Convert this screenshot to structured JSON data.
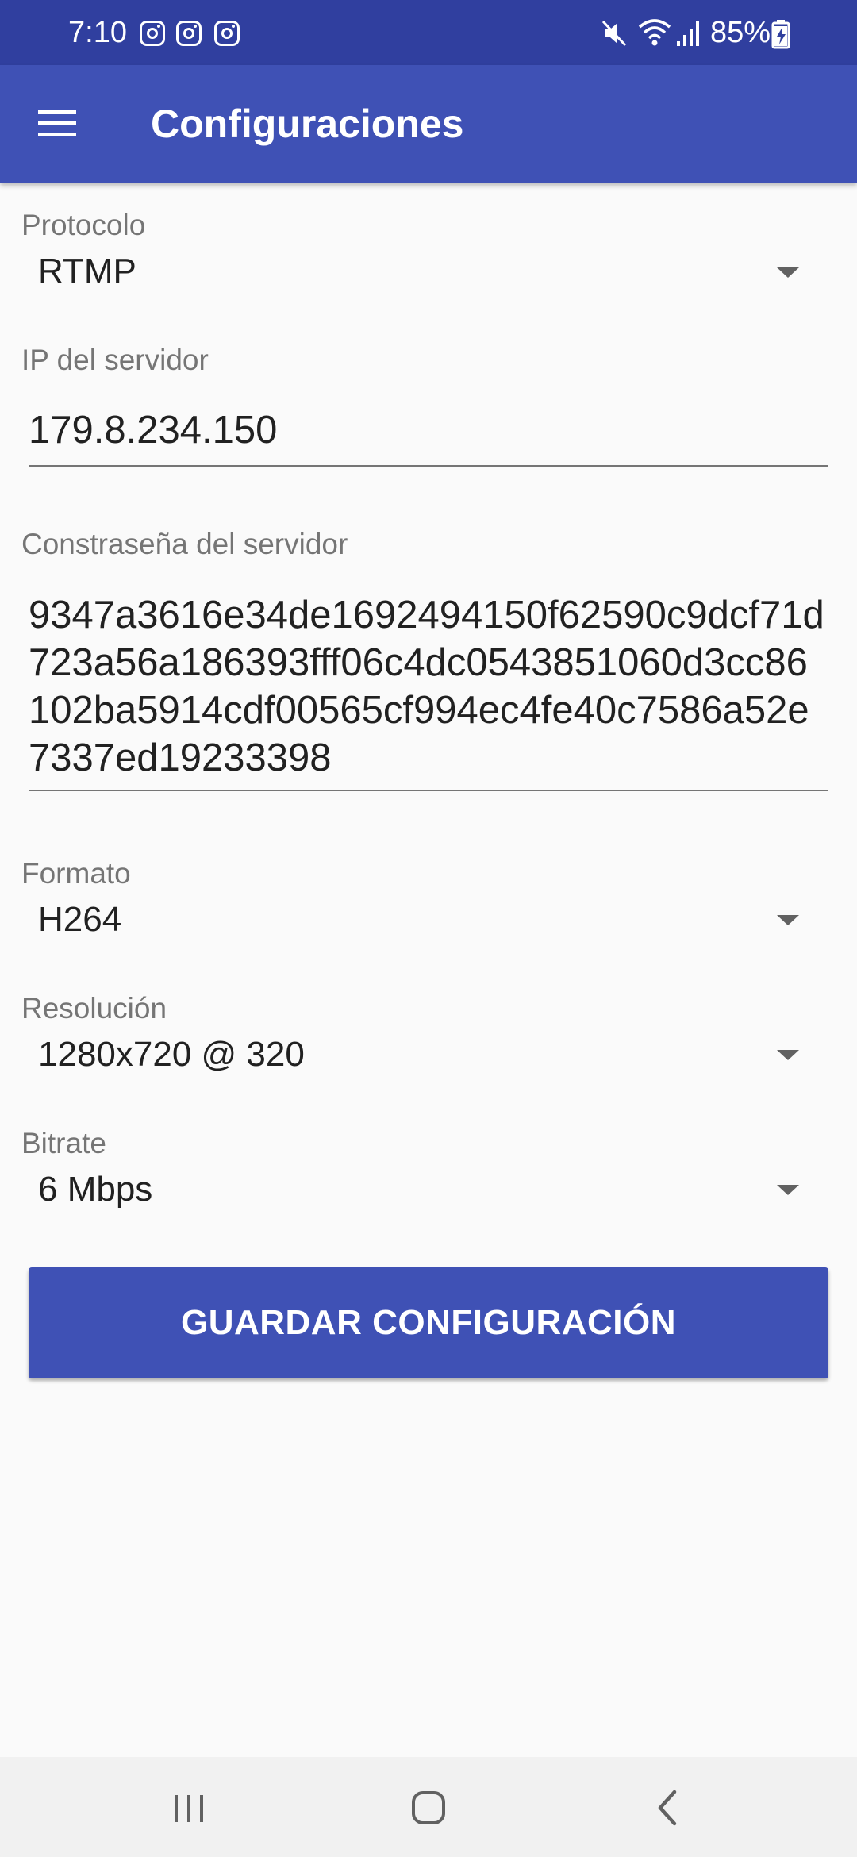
{
  "status_bar": {
    "time": "7:10",
    "notification_icons": [
      "instagram-icon",
      "instagram-icon",
      "instagram-icon"
    ],
    "battery": "85%",
    "system_icons": [
      "mute-icon",
      "wifi-icon",
      "signal-icon",
      "battery-charging-icon"
    ]
  },
  "app_bar": {
    "title": "Configuraciones",
    "menu_icon": "hamburger-menu-icon",
    "color": "#3f51b5",
    "status_color": "#303f9f"
  },
  "form": {
    "protocol": {
      "label": "Protocolo",
      "value": "RTMP"
    },
    "server_ip": {
      "label": "IP del servidor",
      "value": "179.8.234.150"
    },
    "server_password": {
      "label": "Constraseña del servidor",
      "value": "9347a3616e34de1692494150f62590c9dcf71d723a56a186393fff06c4dc0543851060d3cc86102ba5914cdf00565cf994ec4fe40c7586a52e7337ed19233398"
    },
    "format": {
      "label": "Formato",
      "value": "H264"
    },
    "resolution": {
      "label": "Resolución",
      "value": "1280x720 @ 320"
    },
    "bitrate": {
      "label": "Bitrate",
      "value": "6 Mbps"
    }
  },
  "save_button": {
    "label": "GUARDAR CONFIGURACIÓN",
    "color": "#3f51b5"
  },
  "nav_bar": {
    "buttons": [
      "recent-apps-icon",
      "home-icon",
      "back-icon"
    ]
  }
}
